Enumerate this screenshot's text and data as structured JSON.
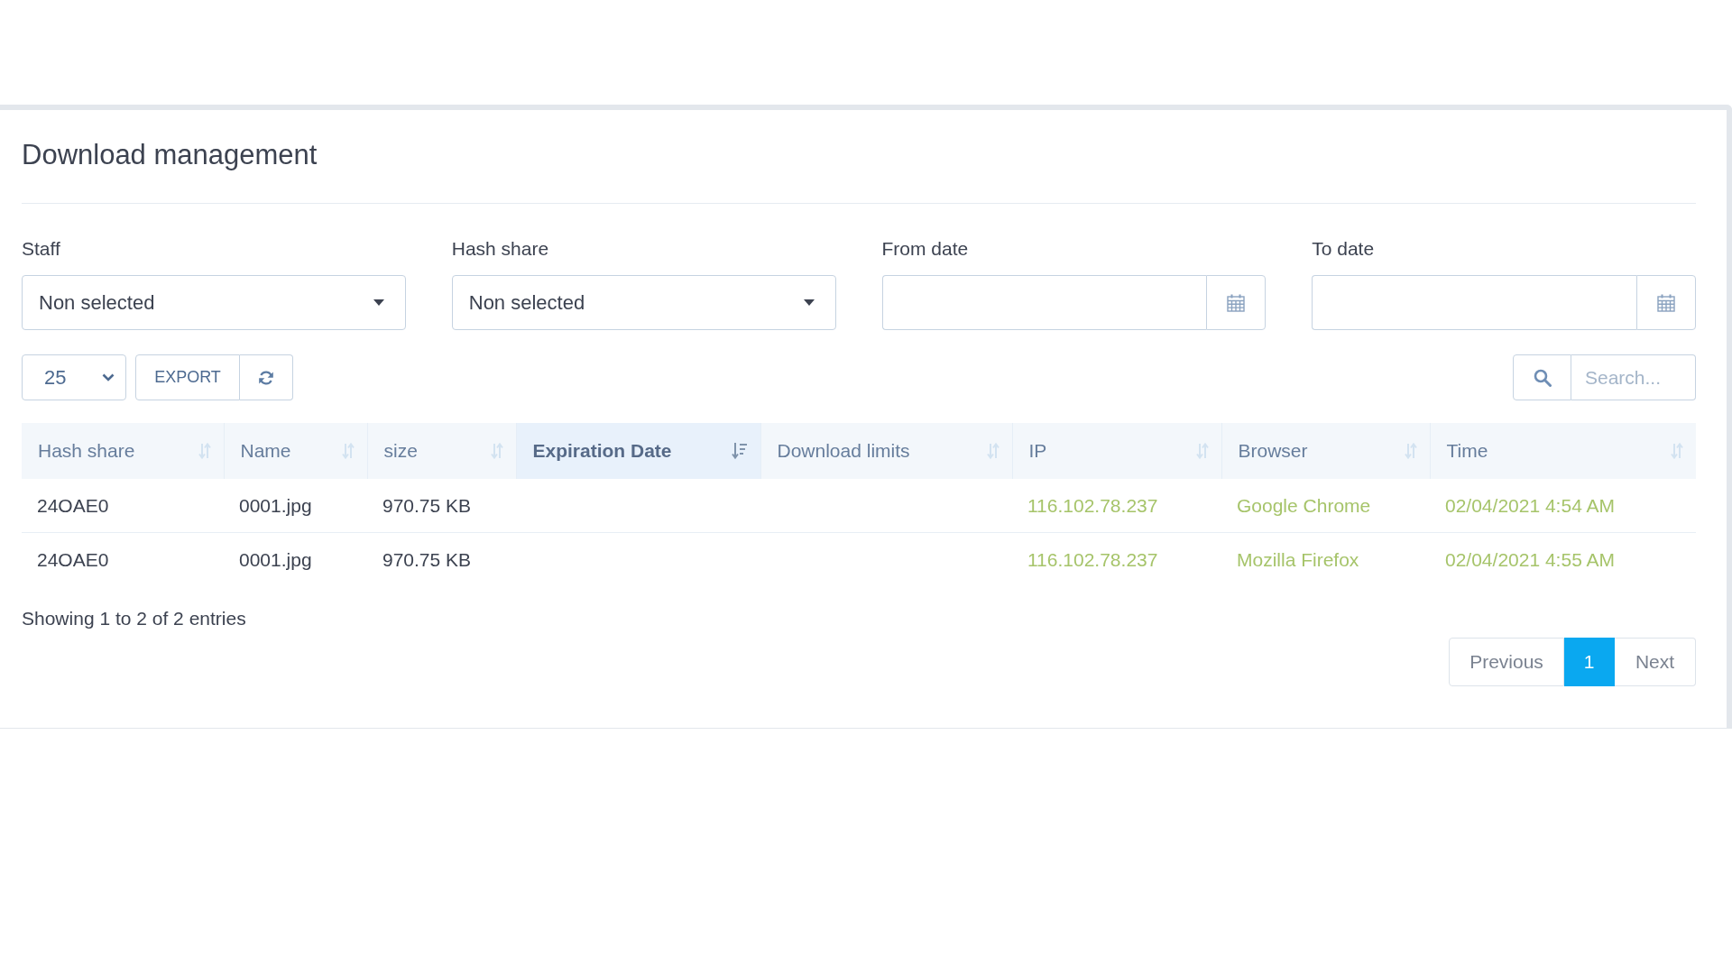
{
  "panel": {
    "title": "Download management"
  },
  "filters": [
    {
      "label": "Staff",
      "kind": "select",
      "value": "Non selected"
    },
    {
      "label": "Hash share",
      "kind": "select",
      "value": "Non selected"
    },
    {
      "label": "From date",
      "kind": "date"
    },
    {
      "label": "To date",
      "kind": "date"
    }
  ],
  "toolbar": {
    "page_length": "25",
    "export_button": "EXPORT",
    "search": {
      "placeholder": "Search..."
    }
  },
  "table": {
    "columns": [
      {
        "label": "Hash share",
        "sorted": false,
        "kind": "plain"
      },
      {
        "label": "Name",
        "sorted": false,
        "kind": "plain"
      },
      {
        "label": "size",
        "sorted": false,
        "kind": "plain"
      },
      {
        "label": "Expiration Date",
        "sorted": true,
        "kind": "plain"
      },
      {
        "label": "Download limits",
        "sorted": false,
        "kind": "plain"
      },
      {
        "label": "IP",
        "sorted": false,
        "kind": "accent"
      },
      {
        "label": "Browser",
        "sorted": false,
        "kind": "accent"
      },
      {
        "label": "Time",
        "sorted": false,
        "kind": "accent"
      }
    ],
    "rows": [
      {
        "hash_share": "24OAE0",
        "name": "0001.jpg",
        "size": "970.75 KB",
        "ip": "116.102.78.237",
        "browser": "Google Chrome",
        "time": "02/04/2021 4:54 AM"
      },
      {
        "hash_share": "24OAE0",
        "name": "0001.jpg",
        "size": "970.75 KB",
        "ip": "116.102.78.237",
        "browser": "Mozilla Firefox",
        "time": "02/04/2021 4:55 AM"
      }
    ]
  },
  "info": "Showing 1 to 2 of 2 entries",
  "pagination": {
    "previous": "Previous",
    "pages": [
      {
        "label": "1",
        "selected": true
      }
    ],
    "next": "Next"
  }
}
